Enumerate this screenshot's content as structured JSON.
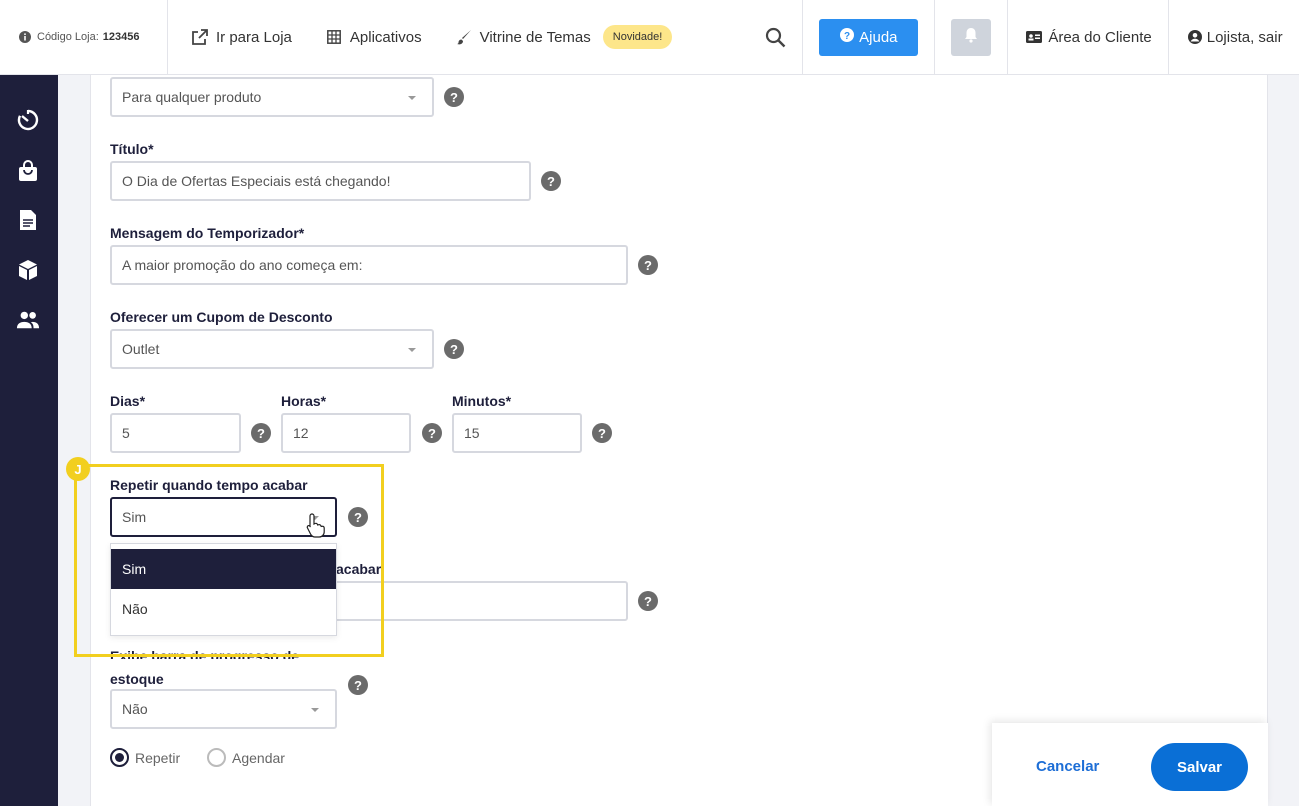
{
  "topbar": {
    "store_code_label": "Código Loja:",
    "store_code": "123456",
    "go_to_store": "Ir para Loja",
    "apps": "Aplicativos",
    "themes": "Vitrine de Temas",
    "new_badge": "Novidade!",
    "help": "Ajuda",
    "client_area": "Área do Cliente",
    "logout": "Lojista, sair"
  },
  "sidebar": {
    "icons": [
      "timer-icon",
      "shopping-bag-icon",
      "document-icon",
      "box-icon",
      "users-icon"
    ]
  },
  "form": {
    "product_select": "Para qualquer produto",
    "title_label": "Título*",
    "title_value": "O Dia de Ofertas Especiais está chegando!",
    "timer_message_label": "Mensagem do Temporizador*",
    "timer_message_value": "A maior promoção do ano começa em:",
    "coupon_label": "Oferecer um Cupom de Desconto",
    "coupon_value": "Outlet",
    "days_label": "Dias*",
    "days_value": "5",
    "hours_label": "Horas*",
    "hours_value": "12",
    "minutes_label": "Minutos*",
    "minutes_value": "15",
    "repeat_label": "Repetir quando tempo acabar",
    "repeat_value": "Sim",
    "repeat_options": [
      "Sim",
      "Não"
    ],
    "hidden_label_tail": "acabar",
    "stock_bar_label_line1": "Exibe barra de progresso de",
    "stock_bar_label_line2": "estoque",
    "stock_bar_value": "Não",
    "help_glyph": "?",
    "radio_repeat": "Repetir",
    "radio_schedule": "Agendar",
    "highlight_marker": "J"
  },
  "actions": {
    "cancel": "Cancelar",
    "save": "Salvar"
  },
  "colors": {
    "sidebar": "#1e1f3b",
    "primary": "#2b8ff0",
    "highlight": "#f2cf1f"
  }
}
